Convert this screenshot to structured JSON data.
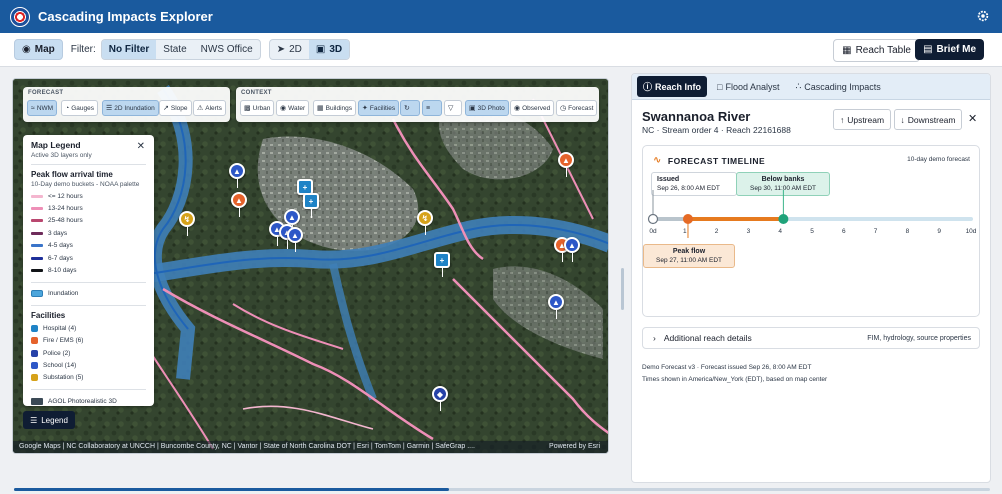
{
  "header": {
    "title": "Cascading Impacts Explorer"
  },
  "toolbar": {
    "map_label": "Map",
    "filter_label": "Filter:",
    "filters": [
      "No Filter",
      "State",
      "NWS Office"
    ],
    "views": [
      "2D",
      "3D"
    ],
    "reach_table_label": "Reach Table",
    "brief_label": "Brief Me"
  },
  "map": {
    "forecast_label": "FORECAST",
    "forecast_chips": [
      "NWM",
      "Gauges",
      "2D Inundation",
      "Slope",
      "Alerts"
    ],
    "context_label": "CONTEXT",
    "context_chips": [
      "Urban",
      "Water",
      "Buildings",
      "Facilities",
      "3D Photo",
      "Observed",
      "Forecast"
    ],
    "attribution": "Google Maps | NC Collaboratory at UNCCH | Buncombe County, NC | Vantor | State of North Carolina DOT | Esri | TomTom | Garmin | SafeGrap ....",
    "powered_by": "Powered by Esri",
    "legend_button": "Legend"
  },
  "legend": {
    "title": "Map Legend",
    "subtitle": "Active 3D layers only",
    "peak_title": "Peak flow arrival time",
    "peak_subtitle": "10-Day demo buckets - NOAA palette",
    "peak_items": [
      {
        "label": "<= 12 hours",
        "color": "#f4b6cf"
      },
      {
        "label": "13-24 hours",
        "color": "#ee8fb7"
      },
      {
        "label": "25-48 hours",
        "color": "#b9476f"
      },
      {
        "label": "3 days",
        "color": "#6e2b5a"
      },
      {
        "label": "4-5 days",
        "color": "#3a74c9"
      },
      {
        "label": "6-7 days",
        "color": "#1e2f9a"
      },
      {
        "label": "8-10 days",
        "color": "#111418"
      }
    ],
    "inundation_label": "Inundation",
    "facilities_title": "Facilities",
    "facilities": [
      {
        "label": "Hospital (4)",
        "color": "#1f83c6"
      },
      {
        "label": "Fire / EMS (6)",
        "color": "#e5622b"
      },
      {
        "label": "Police (2)",
        "color": "#2742a8"
      },
      {
        "label": "School (14)",
        "color": "#2d57c7"
      },
      {
        "label": "Substation (5)",
        "color": "#d6a21a"
      }
    ],
    "agol_label": "AGOL Photorealistic 3D"
  },
  "side": {
    "tabs": [
      "Reach Info",
      "Flood Analyst",
      "Cascading Impacts"
    ],
    "reach_name": "Swannanoa River",
    "reach_sub": "NC · Stream order 4 · Reach 22161688",
    "upstream_label": "Upstream",
    "downstream_label": "Downstream",
    "forecast_title": "FORECAST TIMELINE",
    "forecast_note": "10-day demo forecast",
    "ticks": [
      "0d",
      "1",
      "2",
      "3",
      "4",
      "5",
      "6",
      "7",
      "8",
      "9",
      "10d"
    ],
    "issued": {
      "title": "Issued",
      "time": "Sep 26, 8:00 AM EDT",
      "day": 0
    },
    "peak": {
      "title": "Peak flow",
      "time": "Sep 27, 11:00 AM EDT",
      "day": 1.1
    },
    "below": {
      "title": "Below banks",
      "time": "Sep 30, 11:00 AM EDT",
      "day": 4.1
    },
    "details_label": "Additional reach details",
    "details_meta": "FIM, hydrology, source properties",
    "footer_line1": "Demo Forecast v3 · Forecast issued Sep 26, 8:00 AM EDT",
    "footer_line2": "Times shown in America/New_York (EDT), based on map center"
  }
}
